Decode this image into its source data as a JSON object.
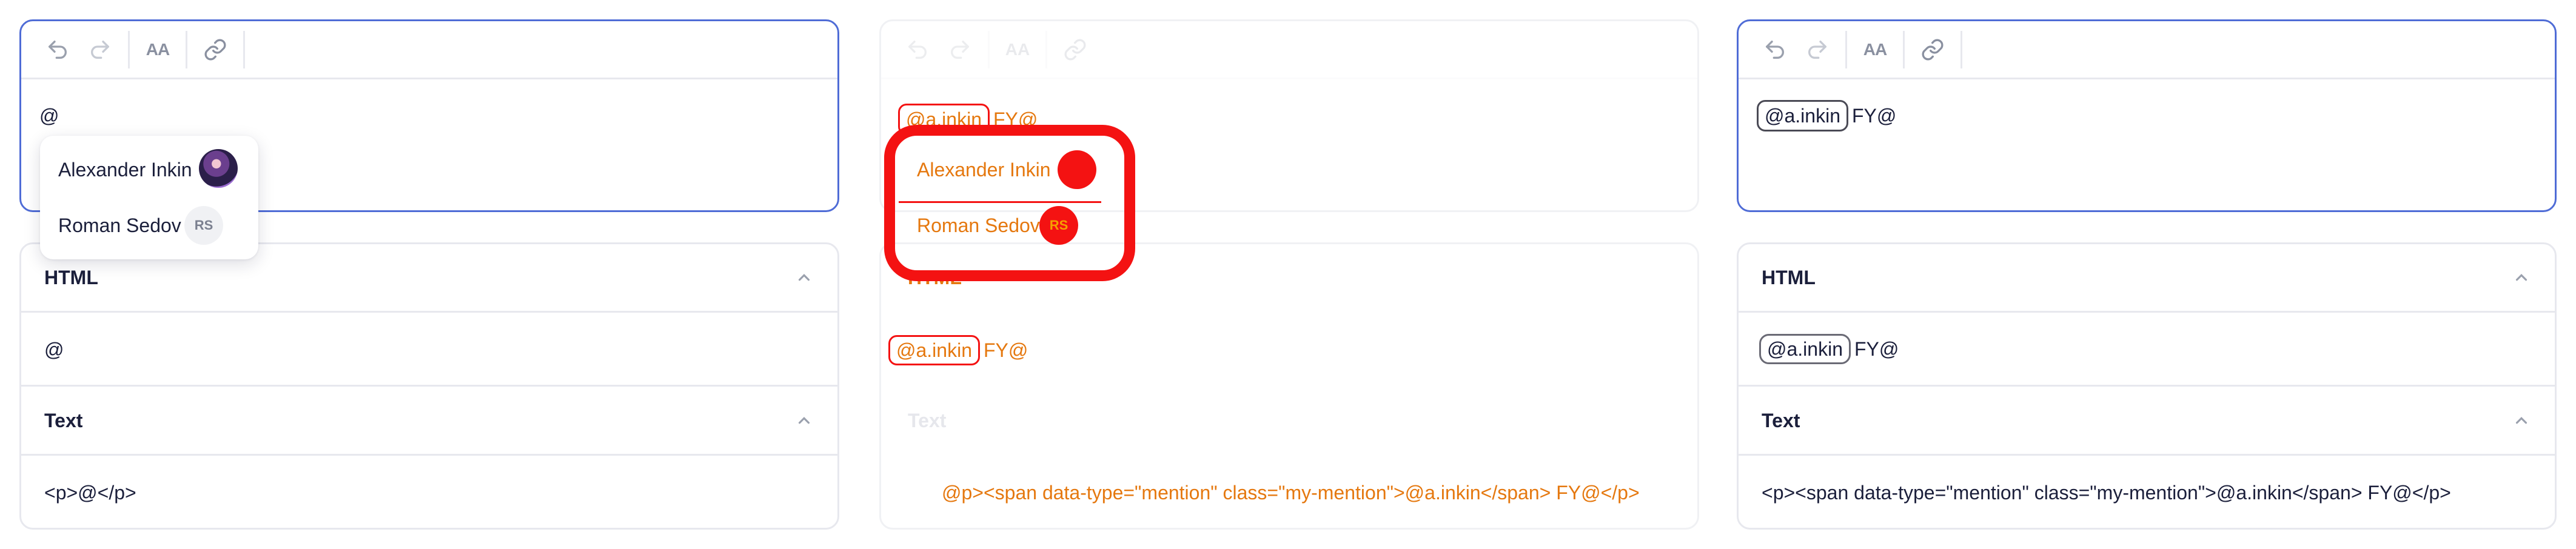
{
  "toolbar": {
    "undo_icon": "undo-icon",
    "redo_icon": "redo-icon",
    "text_size_label": "AA",
    "link_icon": "link-icon"
  },
  "left": {
    "editor_text": "@",
    "mentions": [
      {
        "name": "Alexander Inkin",
        "avatar": "photo"
      },
      {
        "name": "Roman Sedov",
        "avatar": "RS"
      }
    ],
    "html_title": "HTML",
    "html_value": "@",
    "text_title": "Text",
    "text_value": "<p>@</p>"
  },
  "middle": {
    "mention_label": "@a.inkin",
    "trailing_text": "FY@",
    "mentions": [
      {
        "name": "Alexander Inkin",
        "avatar": "photo"
      },
      {
        "name": "Roman Sedov",
        "avatar": "RS"
      }
    ],
    "html_title": "HTML",
    "html_mention": "@a.inkin",
    "html_trailing": "FY@",
    "text_title": "Text",
    "text_value": "<p><span data-type=\"mention\" class=\"my-mention\">@a.inkin</span> FY@</p>",
    "text_value_rendered": "@p><span data-type=\"mention\" class=\"my-mention\">@a.inkin</span> FY@</p>"
  },
  "right": {
    "mention_label": "@a.inkin",
    "trailing_text": "FY@",
    "html_title": "HTML",
    "html_mention": "@a.inkin",
    "html_trailing": "FY@",
    "text_title": "Text",
    "text_value": "<p><span data-type=\"mention\" class=\"my-mention\">@a.inkin</span> FY@</p>"
  },
  "colors": {
    "accent": "#4f6cd6",
    "diff_orange": "#e5780f",
    "diff_red": "#f41212",
    "border": "#e7e8ee"
  }
}
